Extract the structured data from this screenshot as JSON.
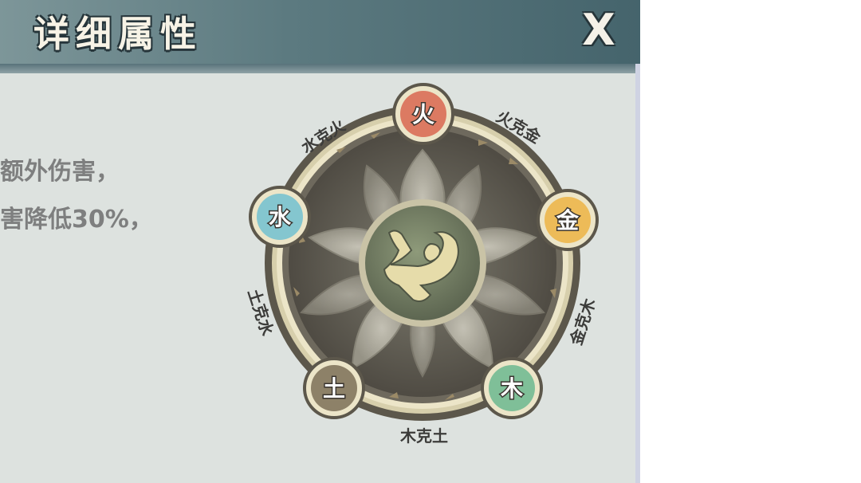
{
  "header": {
    "title": "详细属性",
    "close_label": "X"
  },
  "description": {
    "line1": "额外伤害，",
    "line2": "害降低30%，"
  },
  "wheel": {
    "elements": [
      {
        "key": "fire",
        "char": "火",
        "color": "#dc7a62"
      },
      {
        "key": "metal",
        "char": "金",
        "color": "#edbb58"
      },
      {
        "key": "wood",
        "char": "木",
        "color": "#7fbf98"
      },
      {
        "key": "earth",
        "char": "土",
        "color": "#8d8168"
      },
      {
        "key": "water",
        "char": "水",
        "color": "#84c6cf"
      }
    ],
    "relations": {
      "water_fire": "水克火",
      "fire_metal": "火克金",
      "metal_wood": "金克木",
      "wood_earth": "木克土",
      "earth_water": "土克水"
    },
    "center_icon": "swirl-emblem"
  }
}
